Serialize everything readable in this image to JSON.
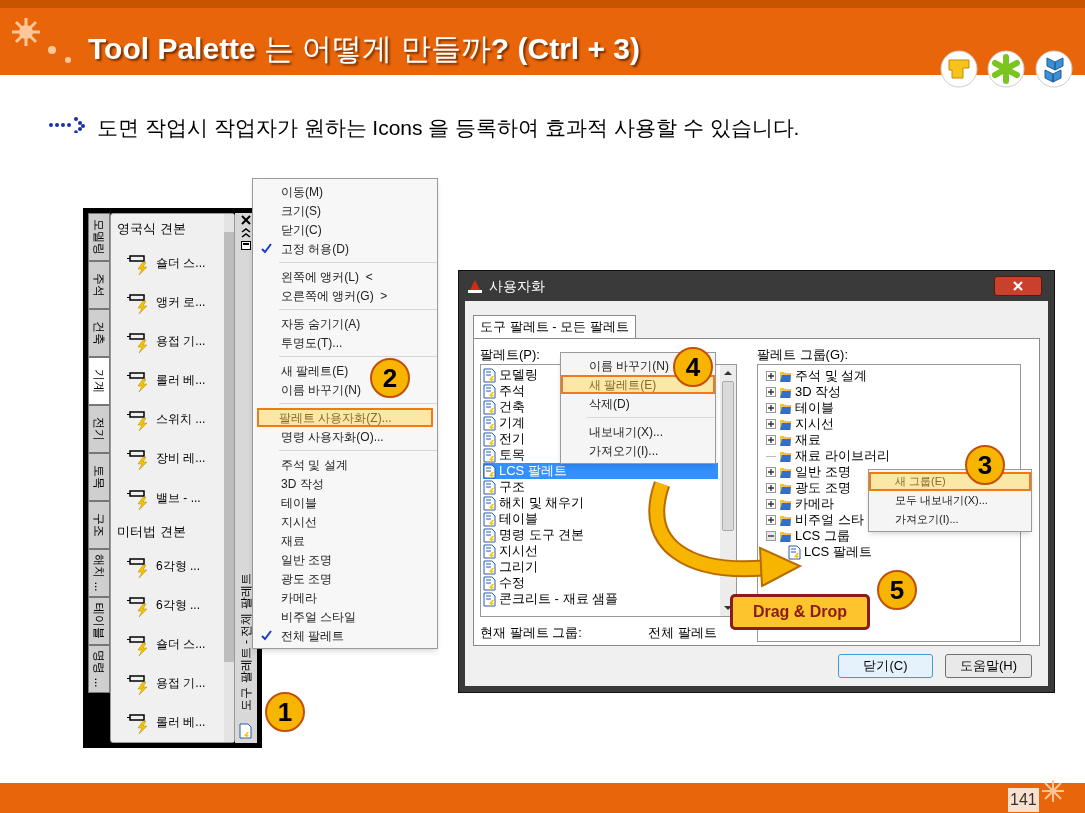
{
  "header": {
    "title": "**Tool Palette** 는 어떻게 만들까**? (Ctrl + 3)**"
  },
  "intro": "도면 작업시 작업자가 원하는 Icons 을 등록하여 효과적 사용할 수 있습니다.",
  "palette": {
    "tabs": [
      {
        "label": "모델링",
        "selected": false
      },
      {
        "label": "주석",
        "selected": false
      },
      {
        "label": "건축",
        "selected": false
      },
      {
        "label": "기계",
        "selected": true
      },
      {
        "label": "전기",
        "selected": false
      },
      {
        "label": "토목",
        "selected": false
      },
      {
        "label": "구조",
        "selected": false
      },
      {
        "label": "해치 ...",
        "selected": false
      },
      {
        "label": "테이블",
        "selected": false
      },
      {
        "label": "명령 ...",
        "selected": false
      }
    ],
    "sections": [
      {
        "title": "영국식 견본",
        "items": [
          "숄더 스...",
          "앵커 로...",
          "용접 기...",
          "롤러 베...",
          "스위치 ...",
          "장비 레...",
          "밸브 - ..."
        ]
      },
      {
        "title": "미터법 견본",
        "items": [
          "6각형 ...",
          "6각형 ...",
          "숄더 스...",
          "용접 기...",
          "롤러 베..."
        ]
      }
    ],
    "side_title": "도구 팔레트 - 전체 팔레트"
  },
  "context_menu": {
    "groups": [
      [
        {
          "label": "이동(M)",
          "checked": false,
          "selected": false
        },
        {
          "label": "크기(S)",
          "checked": false,
          "selected": false
        },
        {
          "label": "닫기(C)",
          "checked": false,
          "selected": false
        },
        {
          "label": "고정 허용(D)",
          "checked": true,
          "selected": false
        }
      ],
      [
        {
          "label": "왼쪽에 앵커(L)",
          "suffix": "<",
          "checked": false,
          "selected": false
        },
        {
          "label": "오른쪽에 앵커(G)",
          "suffix": ">",
          "checked": false,
          "selected": false
        }
      ],
      [
        {
          "label": "자동 숨기기(A)",
          "checked": false,
          "selected": false
        },
        {
          "label": "투명도(T)...",
          "checked": false,
          "selected": false
        }
      ],
      [
        {
          "label": "새 팔레트(E)",
          "checked": false,
          "selected": false
        },
        {
          "label": "이름 바꾸기(N)",
          "checked": false,
          "selected": false
        }
      ],
      [
        {
          "label": "팔레트 사용자화(Z)...",
          "checked": false,
          "selected": true
        },
        {
          "label": "명령 사용자화(O)...",
          "checked": false,
          "selected": false
        }
      ],
      [
        {
          "label": "주석 및 설계",
          "checked": false,
          "selected": false
        },
        {
          "label": "3D 작성",
          "checked": false,
          "selected": false
        },
        {
          "label": "테이블",
          "checked": false,
          "selected": false
        },
        {
          "label": "지시선",
          "checked": false,
          "selected": false
        },
        {
          "label": "재료",
          "checked": false,
          "selected": false
        },
        {
          "label": "일반 조명",
          "checked": false,
          "selected": false
        },
        {
          "label": "광도 조명",
          "checked": false,
          "selected": false
        },
        {
          "label": "카메라",
          "checked": false,
          "selected": false
        },
        {
          "label": "비주얼 스타일",
          "checked": false,
          "selected": false
        },
        {
          "label": "전체 팔레트",
          "checked": true,
          "selected": false
        }
      ]
    ]
  },
  "dialog": {
    "title": "사용자화",
    "tab": "도구 팔레트 - 모든 팔레트",
    "palettes_label": "팔레트(P):",
    "palettes": [
      {
        "label": "모델링",
        "selected": false
      },
      {
        "label": "주석",
        "selected": false
      },
      {
        "label": "건축",
        "selected": false
      },
      {
        "label": "기계",
        "selected": false
      },
      {
        "label": "전기",
        "selected": false
      },
      {
        "label": "토목",
        "selected": false
      },
      {
        "label": "LCS 팔레트",
        "selected": true
      },
      {
        "label": "구조",
        "selected": false
      },
      {
        "label": "해치 및 채우기",
        "selected": false
      },
      {
        "label": "테이블",
        "selected": false
      },
      {
        "label": "명령 도구 견본",
        "selected": false
      },
      {
        "label": "지시선",
        "selected": false
      },
      {
        "label": "그리기",
        "selected": false
      },
      {
        "label": "수정",
        "selected": false
      },
      {
        "label": "콘크리트 - 재료 샘플",
        "selected": false
      }
    ],
    "palette_menu": [
      [
        {
          "label": "이름 바꾸기(N)",
          "selected": false
        },
        {
          "label": "새 팔레트(E)",
          "selected": true
        },
        {
          "label": "삭제(D)",
          "selected": false
        }
      ],
      [
        {
          "label": "내보내기(X)...",
          "selected": false
        },
        {
          "label": "가져오기(I)...",
          "selected": false
        }
      ]
    ],
    "groups_label": "팔레트 그룹(G):",
    "groups": [
      {
        "kind": "folder",
        "label": "주석 및 설계",
        "expanded": false
      },
      {
        "kind": "folder",
        "label": "3D 작성",
        "expanded": false
      },
      {
        "kind": "folder",
        "label": "테이블",
        "expanded": false
      },
      {
        "kind": "folder",
        "label": "지시선",
        "expanded": false
      },
      {
        "kind": "folder",
        "label": "재료",
        "expanded": false
      },
      {
        "kind": "leaf-folder",
        "label": "재료 라이브러리"
      },
      {
        "kind": "folder",
        "label": "일반 조명",
        "expanded": false
      },
      {
        "kind": "folder",
        "label": "광도 조명",
        "expanded": false
      },
      {
        "kind": "folder",
        "label": "카메라",
        "expanded": false
      },
      {
        "kind": "folder",
        "label": "비주얼 스타",
        "expanded": false
      },
      {
        "kind": "folder",
        "label": "LCS 그룹",
        "expanded": true,
        "children": [
          {
            "kind": "palette",
            "label": "LCS 팔레트"
          }
        ]
      }
    ],
    "group_menu": [
      {
        "label": "새 그룹(E)",
        "selected": true
      },
      {
        "label": "모두 내보내기(X)...",
        "selected": false
      },
      {
        "label": "가져오기(I)...",
        "selected": false
      }
    ],
    "current_group_label": "현재 팔레트 그룹:",
    "current_group_value": "전체 팔레트",
    "buttons": [
      "닫기(C)",
      "도움말(H)"
    ]
  },
  "callouts": [
    "1",
    "2",
    "3",
    "4",
    "5"
  ],
  "drag_label": "Drag & Drop",
  "page_number": "141"
}
